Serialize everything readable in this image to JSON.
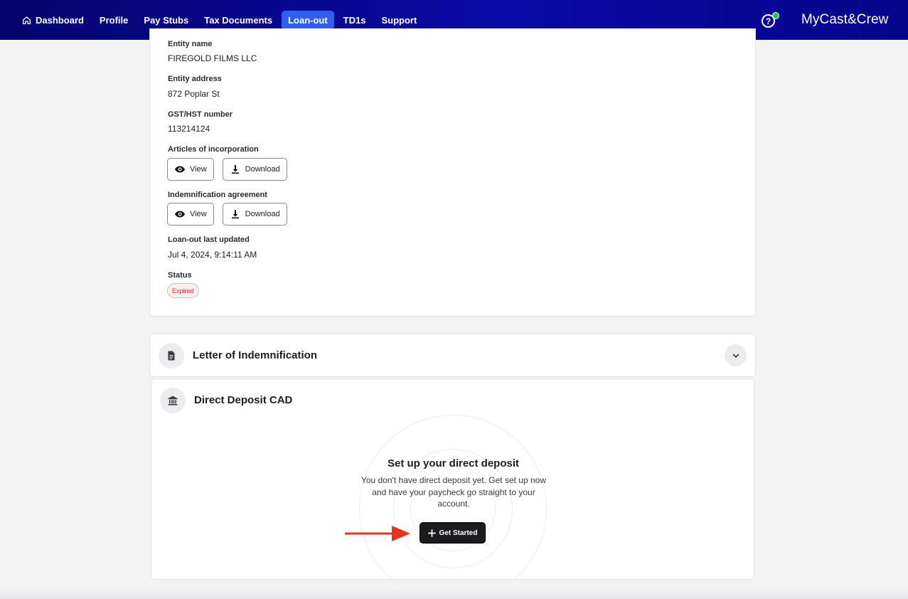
{
  "nav": {
    "items": [
      {
        "label": "Dashboard",
        "icon": "home-icon",
        "active": false
      },
      {
        "label": "Profile",
        "active": false
      },
      {
        "label": "Pay Stubs",
        "active": false
      },
      {
        "label": "Tax Documents",
        "active": false
      },
      {
        "label": "Loan-out",
        "active": true
      },
      {
        "label": "TD1s",
        "active": false
      },
      {
        "label": "Support",
        "active": false
      }
    ],
    "help_icon": "question-circle-icon",
    "help_glyph": "?",
    "brand": "MyCast&Crew",
    "accent_color": "#2f5ff0",
    "bar_color": "#0a0aa8"
  },
  "entity": {
    "entity_name_label": "Entity name",
    "entity_name_value": "FIREGOLD FILMS LLC",
    "entity_address_label": "Entity address",
    "entity_address_value": "872 Poplar St",
    "gst_label": "GST/HST number",
    "gst_value": "113214124",
    "articles_label": "Articles of incorporation",
    "indemnification_label": "Indemnification agreement",
    "view_label": "View",
    "download_label": "Download",
    "updated_label": "Loan-out last updated",
    "updated_value": "Jul 4, 2024, 9:14:11 AM",
    "status_label": "Status",
    "status_value": "Expired",
    "status_color": "#c83232"
  },
  "letter": {
    "title": "Letter of Indemnification",
    "icon": "document-icon",
    "expanded": false
  },
  "deposit": {
    "title": "Direct Deposit CAD",
    "icon": "bank-icon",
    "setup_title": "Set up your direct deposit",
    "setup_text": "You don't have direct deposit yet. Get set up now and have your paycheck go straight to your account.",
    "button_label": "Get Started",
    "annotation_arrow_color": "#e8321e"
  }
}
